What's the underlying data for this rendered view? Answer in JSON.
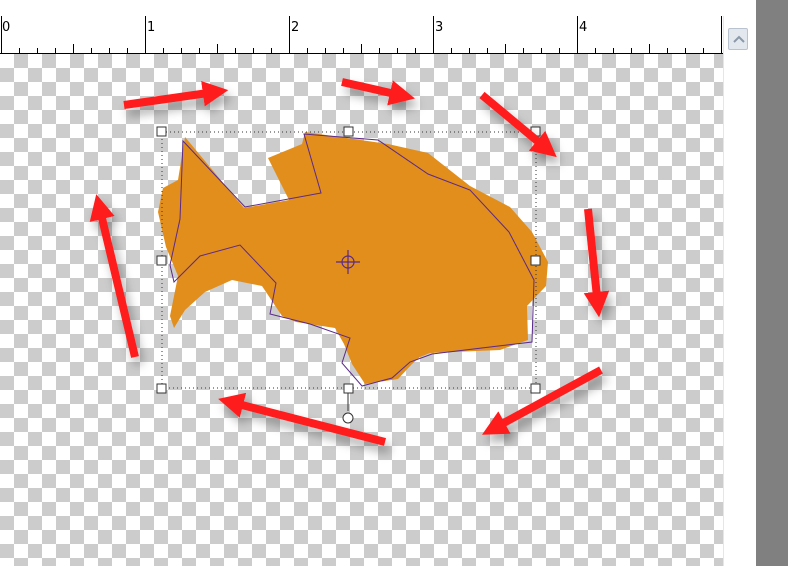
{
  "ruler": {
    "labels": [
      "0",
      "1",
      "2",
      "3",
      "4"
    ]
  },
  "colors": {
    "shape_fill": "#e28e1c",
    "shape_outline": "#5a2a8a",
    "arrow": "#ff1c1c",
    "checker_dark": "#cccccc",
    "checker_light": "#ffffff",
    "side_panel": "#808080"
  },
  "icons": {
    "scroll_up": "chevron-up-icon",
    "center_point": "crosshair-icon",
    "rotate_handle": "rotate-handle-icon"
  }
}
